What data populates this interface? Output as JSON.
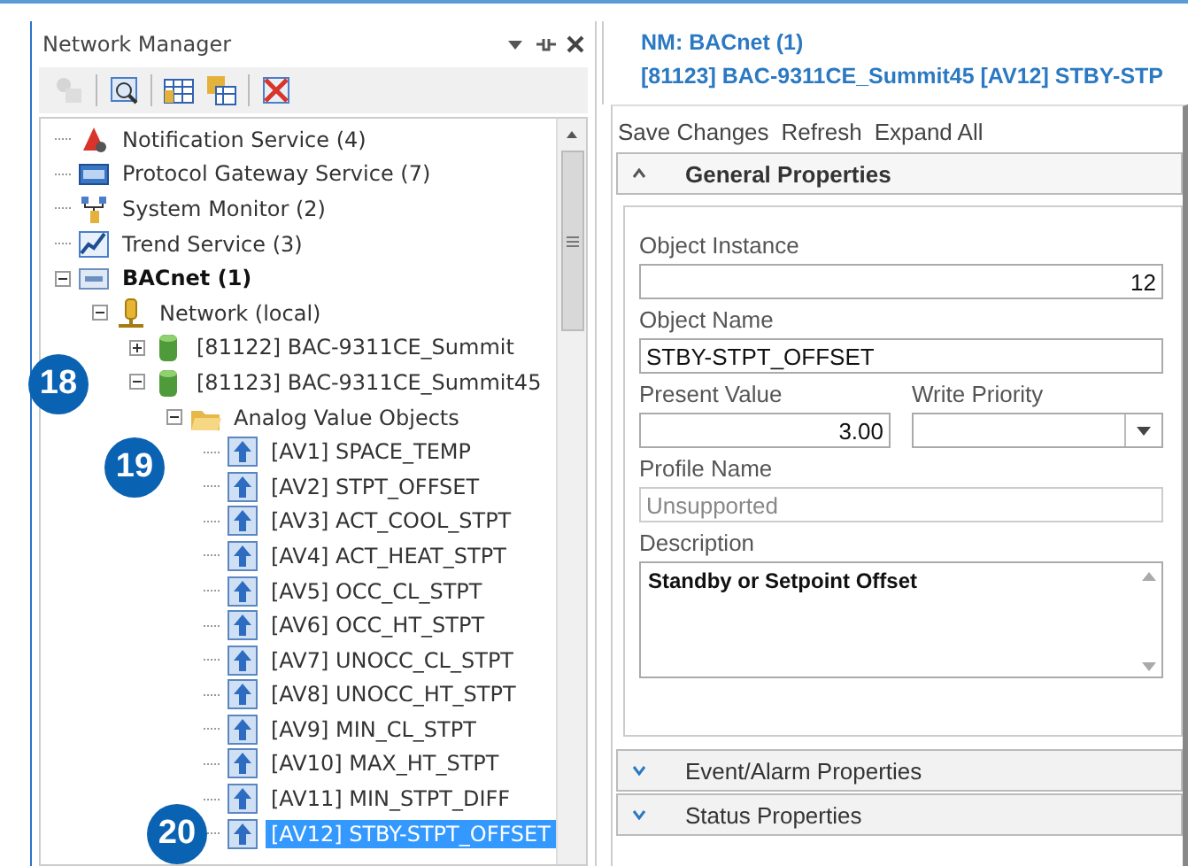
{
  "network_manager": {
    "title": "Network Manager",
    "toolbar": [
      {
        "kind": "add",
        "disabled": true
      },
      {
        "kind": "find",
        "disabled": false
      },
      {
        "kind": "table",
        "disabled": false
      },
      {
        "kind": "copy",
        "disabled": false
      },
      {
        "kind": "delete",
        "disabled": false
      }
    ],
    "tree": [
      {
        "label": "Notification Service (4)",
        "kind": "alarm",
        "selected": false
      },
      {
        "label": "Protocol Gateway Service (7)",
        "kind": "gateway",
        "selected": false
      },
      {
        "label": "System Monitor (2)",
        "kind": "monitor",
        "selected": false
      },
      {
        "label": "Trend Service (3)",
        "kind": "trend",
        "selected": false
      },
      {
        "label": "BACnet (1)",
        "kind": "bacnet",
        "selected": false,
        "expanded": true,
        "children": [
          {
            "label": "Network (local)",
            "kind": "network",
            "selected": false,
            "expanded": true,
            "children": [
              {
                "label": "[81122] BAC-9311CE_Summit",
                "kind": "device",
                "selected": false,
                "expanded": false
              },
              {
                "label": "[81123] BAC-9311CE_Summit45",
                "kind": "device",
                "selected": false,
                "expanded": true,
                "children": [
                  {
                    "label": "Analog Value Objects",
                    "kind": "folder",
                    "selected": false,
                    "expanded": true,
                    "children": [
                      {
                        "label": "[AV1] SPACE_TEMP",
                        "kind": "object",
                        "selected": false
                      },
                      {
                        "label": "[AV2] STPT_OFFSET",
                        "kind": "object",
                        "selected": false
                      },
                      {
                        "label": "[AV3] ACT_COOL_STPT",
                        "kind": "object",
                        "selected": false
                      },
                      {
                        "label": "[AV4] ACT_HEAT_STPT",
                        "kind": "object",
                        "selected": false
                      },
                      {
                        "label": "[AV5] OCC_CL_STPT",
                        "kind": "object",
                        "selected": false
                      },
                      {
                        "label": "[AV6] OCC_HT_STPT",
                        "kind": "object",
                        "selected": false
                      },
                      {
                        "label": "[AV7] UNOCC_CL_STPT",
                        "kind": "object",
                        "selected": false
                      },
                      {
                        "label": "[AV8] UNOCC_HT_STPT",
                        "kind": "object",
                        "selected": false
                      },
                      {
                        "label": "[AV9] MIN_CL_STPT",
                        "kind": "object",
                        "selected": false
                      },
                      {
                        "label": "[AV10] MAX_HT_STPT",
                        "kind": "object",
                        "selected": false
                      },
                      {
                        "label": "[AV11] MIN_STPT_DIFF",
                        "kind": "object",
                        "selected": false
                      },
                      {
                        "label": "[AV12] STBY-STPT_OFFSET",
                        "kind": "object",
                        "selected": true
                      }
                    ]
                  }
                ]
              }
            ]
          }
        ]
      }
    ]
  },
  "properties": {
    "header": [
      "NM: BACnet (1)",
      "[81123] BAC-9311CE_Summit45 [AV12] STBY-STP"
    ],
    "actions": [
      "Save Changes",
      "Refresh",
      "Expand All"
    ],
    "sections": [
      {
        "title": "General Properties",
        "expanded": true,
        "rows": [
          [
            {
              "label": "Object Instance",
              "kind": "number",
              "value": "12",
              "disabled": false
            }
          ],
          [
            {
              "label": "Object Name",
              "kind": "text",
              "value": "STBY-STPT_OFFSET",
              "disabled": false
            }
          ],
          [
            {
              "label": "Present Value",
              "kind": "number",
              "value": "3.00",
              "disabled": false
            },
            {
              "label": "Write Priority",
              "kind": "combo",
              "disabled": false
            }
          ],
          [
            {
              "label": "Profile Name",
              "kind": "text",
              "value": "Unsupported",
              "disabled": true
            }
          ],
          [
            {
              "label": "Description",
              "kind": "textarea",
              "value": "Standby or Setpoint Offset",
              "disabled": false
            }
          ]
        ]
      },
      {
        "title": "Event/Alarm Properties",
        "expanded": false
      },
      {
        "title": "Status Properties",
        "expanded": false
      }
    ]
  },
  "callouts": [
    {
      "text": "18"
    },
    {
      "text": "19"
    },
    {
      "text": "20"
    }
  ]
}
